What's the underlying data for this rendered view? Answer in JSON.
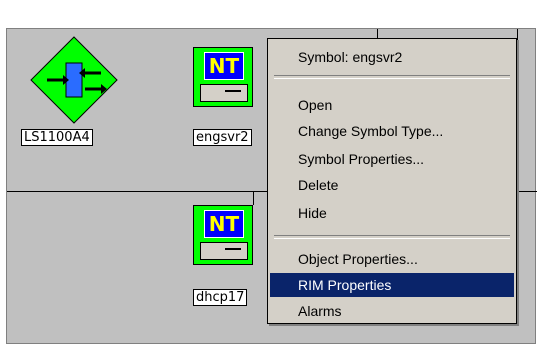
{
  "map": {
    "symbols": [
      {
        "label": "LS1100A4"
      },
      {
        "label": "engsvr2",
        "badge": "NT"
      },
      {
        "label": "dhcp17",
        "badge": "NT"
      }
    ]
  },
  "context_menu": {
    "title": "Symbol: engsvr2",
    "items": [
      {
        "label": "Open"
      },
      {
        "label": "Change Symbol Type..."
      },
      {
        "label": "Symbol Properties..."
      },
      {
        "label": "Delete"
      },
      {
        "label": "Hide"
      },
      {
        "label": "Object Properties..."
      },
      {
        "label": "RIM Properties"
      },
      {
        "label": "Alarms"
      }
    ],
    "highlighted_item": "RIM Properties"
  },
  "colors": {
    "map_background": "#c0c0c0",
    "symbol_green": "#00ff00",
    "highlight": "#0a246a"
  }
}
